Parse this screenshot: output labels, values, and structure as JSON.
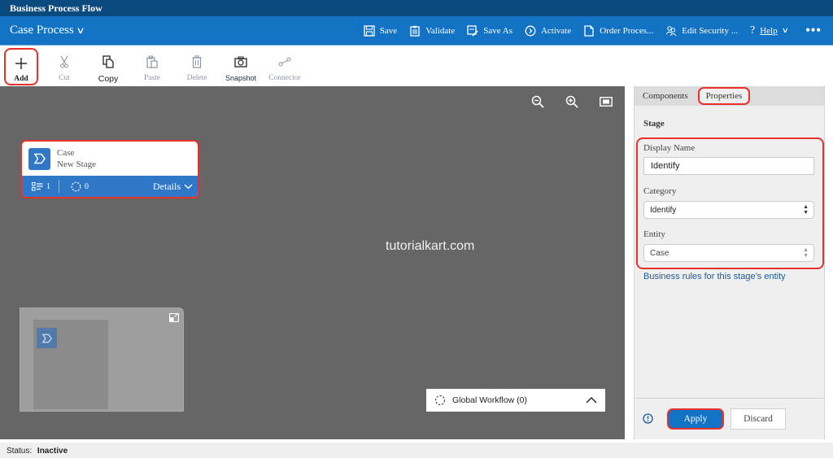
{
  "window": {
    "title": "Business Process Flow"
  },
  "header": {
    "process_name": "Case Process",
    "actions": [
      {
        "label": "Save",
        "icon": "save-icon"
      },
      {
        "label": "Validate",
        "icon": "clipboard-icon"
      },
      {
        "label": "Save As",
        "icon": "save-as-icon"
      },
      {
        "label": "Activate",
        "icon": "activate-icon"
      },
      {
        "label": "Order Proces...",
        "icon": "document-icon"
      },
      {
        "label": "Edit Security ...",
        "icon": "users-icon"
      },
      {
        "label": "Help",
        "icon": "help-icon"
      },
      {
        "label": "•••",
        "icon": "more-icon"
      }
    ]
  },
  "ribbon": {
    "buttons": [
      {
        "label": "Add",
        "icon": "plus-icon",
        "enabled": true
      },
      {
        "label": "Cut",
        "icon": "scissors-icon",
        "enabled": false
      },
      {
        "label": "Copy",
        "icon": "copy-icon",
        "enabled": true
      },
      {
        "label": "Paste",
        "icon": "paste-icon",
        "enabled": false
      },
      {
        "label": "Delete",
        "icon": "trash-icon",
        "enabled": false
      },
      {
        "label": "Snapshot",
        "icon": "camera-icon",
        "enabled": true
      },
      {
        "label": "Connector",
        "icon": "connector-icon",
        "enabled": false
      }
    ]
  },
  "canvas": {
    "watermark": "tutorialkart.com",
    "stage": {
      "entity": "Case",
      "name": "New Stage",
      "steps_count": "1",
      "workflows_count": "0",
      "details_label": "Details"
    },
    "global_workflow": {
      "label": "Global Workflow (0)"
    }
  },
  "panel": {
    "tabs": [
      {
        "label": "Components",
        "active": false
      },
      {
        "label": "Properties",
        "active": true
      }
    ],
    "section_title": "Stage",
    "display_name": {
      "label": "Display Name",
      "value": "Identify"
    },
    "category": {
      "label": "Category",
      "value": "Identify"
    },
    "entity": {
      "label": "Entity",
      "value": "Case"
    },
    "business_rules_link": "Business rules for this stage’s entity",
    "apply_label": "Apply",
    "discard_label": "Discard"
  },
  "status": {
    "label": "Status:",
    "value": "Inactive"
  },
  "colors": {
    "title_bar": "#0b4a7f",
    "command_bar": "#1272c4",
    "canvas": "#666666",
    "stage_blue": "#2f78c8",
    "highlight_red": "#e8312a"
  }
}
